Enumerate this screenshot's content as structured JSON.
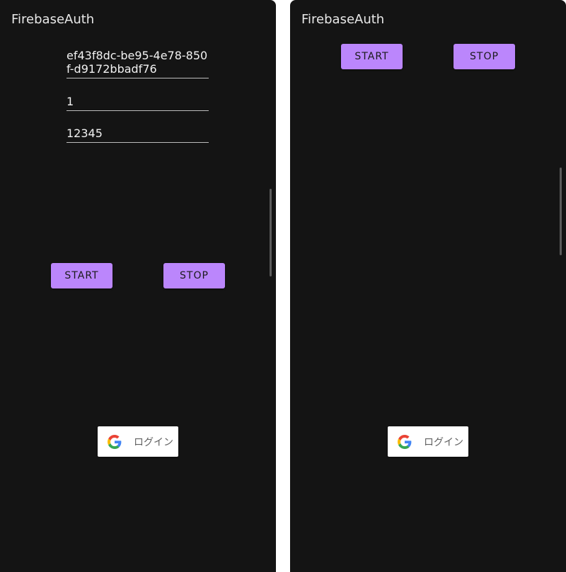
{
  "left_screen": {
    "app_title": "FirebaseAuth",
    "uuid_value": "ef43f8dc-be95-4e78-850f-d9172bbadf76",
    "number_value": "1",
    "code_value": "12345",
    "start_label": "START",
    "stop_label": "STOP",
    "google_login_label": "ログイン"
  },
  "right_screen": {
    "app_title": "FirebaseAuth",
    "start_label": "START",
    "stop_label": "STOP",
    "google_login_label": "ログイン"
  },
  "colors": {
    "background": "#141414",
    "accent_button": "#bb86fc",
    "text": "#e8e8e8"
  },
  "icons": [
    "google-g-icon"
  ]
}
